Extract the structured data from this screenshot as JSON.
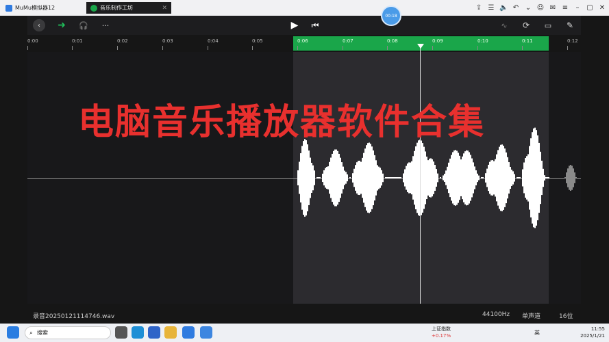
{
  "emulator": {
    "tab1_title": "MuMu模拟器12",
    "tab2_title": "音乐制作工坊",
    "record_timer": "00:18"
  },
  "toolbar": {
    "back": "‹",
    "forward": "➜",
    "headphones": "🎧",
    "more": "···",
    "play": "▶",
    "skip_start": "⏮"
  },
  "ruler": {
    "ticks": [
      "0:00",
      "0:01",
      "0:02",
      "0:03",
      "0:04",
      "0:05",
      "0:06",
      "0:07",
      "0:08",
      "0:09",
      "0:10",
      "0:11",
      "0:12"
    ]
  },
  "overlay_title": "电脑音乐播放器软件合集",
  "file": {
    "name": "录音20250121114746.wav",
    "sample_rate": "44100Hz",
    "channels": "单声道",
    "bit_depth": "16位"
  },
  "taskbar": {
    "search_placeholder": "搜索",
    "stock_name": "上证指数",
    "stock_change": "+0.17%",
    "lang": "英",
    "time": "11:55",
    "date": "2025/1/21"
  },
  "colors": {
    "selection": "#1aa64a",
    "title_red": "#e8302e"
  }
}
